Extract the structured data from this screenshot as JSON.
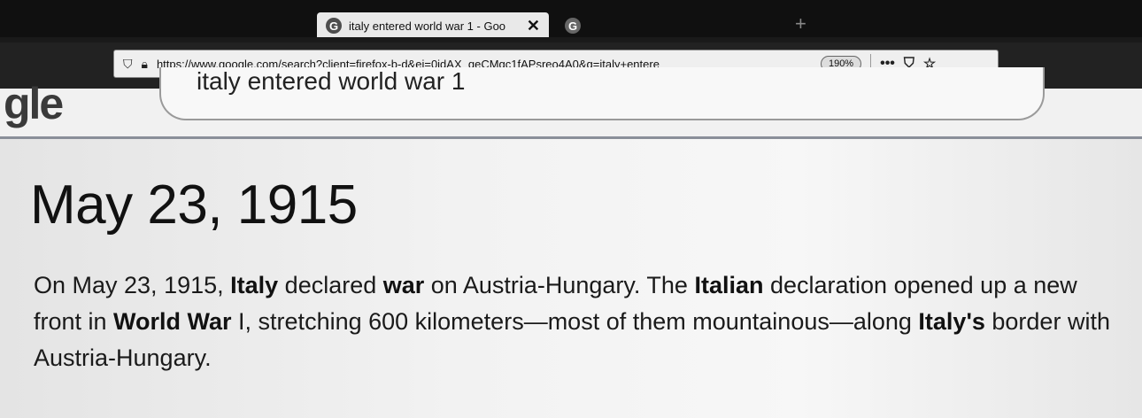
{
  "browser": {
    "active_tab_title": "italy entered world war 1 - Goo",
    "active_tab_favicon": "G",
    "second_tab_favicon": "G",
    "second_tab_title": "",
    "url": "https://www.google.com/search?client=firefox-b-d&ei=0jdAX_qeCMqc1fAPsreo4A0&q=italy+entere",
    "zoom_level": "190%"
  },
  "search": {
    "logo_fragment": "gle",
    "query_text": "italy entered world war 1"
  },
  "answer": {
    "title": "May 23, 1915",
    "segments": [
      {
        "text": "On May 23, 1915, ",
        "bold": false
      },
      {
        "text": "Italy",
        "bold": true
      },
      {
        "text": " declared ",
        "bold": false
      },
      {
        "text": "war",
        "bold": true
      },
      {
        "text": " on Austria-Hungary. The ",
        "bold": false
      },
      {
        "text": "Italian",
        "bold": true
      },
      {
        "text": " declaration opened up a new front in ",
        "bold": false
      },
      {
        "text": "World War",
        "bold": true
      },
      {
        "text": " I, stretching 600 kilometers—most of them mountainous—along ",
        "bold": false
      },
      {
        "text": "Italy's",
        "bold": true
      },
      {
        "text": " border with Austria-Hungary.",
        "bold": false
      }
    ]
  }
}
